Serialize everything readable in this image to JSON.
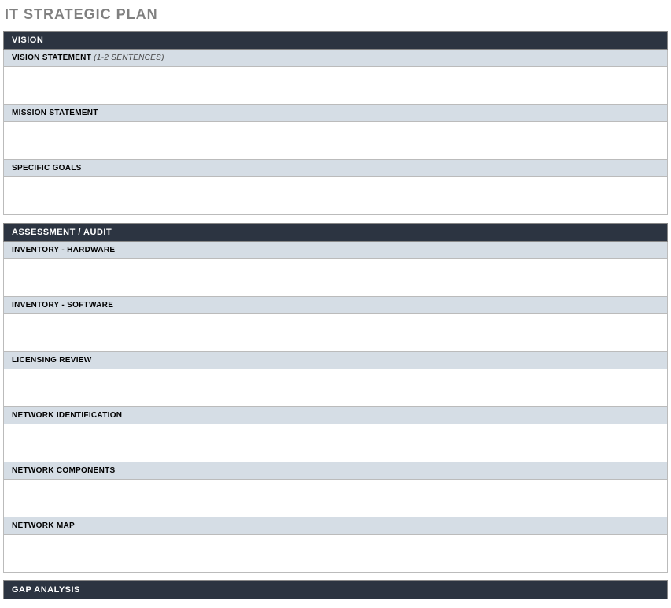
{
  "title": "IT STRATEGIC PLAN",
  "sections": {
    "vision": {
      "header": "VISION",
      "subsections": {
        "vision_statement": {
          "label": "VISION STATEMENT",
          "hint": "(1-2 SENTENCES)",
          "content": ""
        },
        "mission_statement": {
          "label": "MISSION STATEMENT",
          "content": ""
        },
        "specific_goals": {
          "label": "SPECIFIC GOALS",
          "content": ""
        }
      }
    },
    "assessment": {
      "header": "ASSESSMENT / AUDIT",
      "subsections": {
        "inventory_hardware": {
          "label": "INVENTORY - HARDWARE",
          "content": ""
        },
        "inventory_software": {
          "label": "INVENTORY - SOFTWARE",
          "content": ""
        },
        "licensing_review": {
          "label": "LICENSING REVIEW",
          "content": ""
        },
        "network_identification": {
          "label": "NETWORK IDENTIFICATION",
          "content": ""
        },
        "network_components": {
          "label": "NETWORK COMPONENTS",
          "content": ""
        },
        "network_map": {
          "label": "NETWORK MAP",
          "content": ""
        }
      }
    },
    "gap": {
      "header": "GAP ANALYSIS"
    }
  }
}
